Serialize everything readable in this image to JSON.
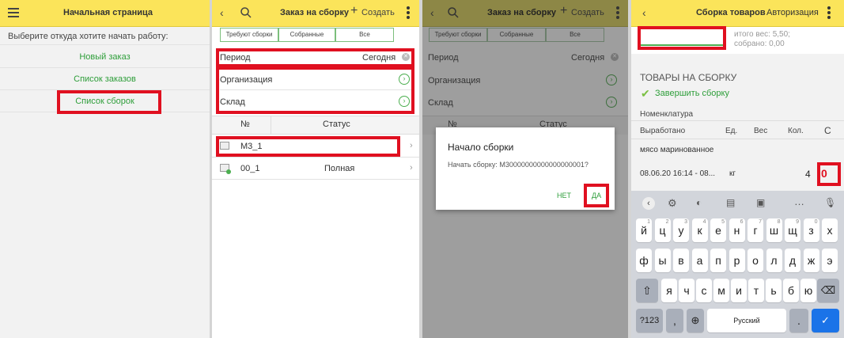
{
  "panel1": {
    "title": "Начальная страница",
    "prompt": "Выберите откуда хотите начать работу:",
    "items": [
      "Новый заказ",
      "Список заказов",
      "Список сборок"
    ]
  },
  "panel2": {
    "title": "Заказ на сборку",
    "create": "Создать",
    "tabs": [
      "Требуют сборки",
      "Собранные",
      "Все"
    ],
    "period_label": "Период",
    "period_value": "Сегодня",
    "org_label": "Организация",
    "warehouse_label": "Склад",
    "col_num": "№",
    "col_status": "Статус",
    "rows": [
      {
        "num": "М3_1",
        "status": ""
      },
      {
        "num": "00_1",
        "status": "Полная"
      }
    ]
  },
  "panel3": {
    "title": "Заказ на сборку",
    "create": "Создать",
    "tabs": [
      "Требуют сборки",
      "Собранные",
      "Все"
    ],
    "period_label": "Период",
    "period_value": "Сегодня",
    "org_label": "Организация",
    "warehouse_label": "Склад",
    "col_num": "№",
    "col_status": "Статус",
    "dialog": {
      "title": "Начало сборки",
      "message": "Начать сборку: М30000000000000000001?",
      "no": "НЕТ",
      "yes": "ДА"
    }
  },
  "panel4": {
    "title": "Сборка товаров",
    "auth": "Авторизация",
    "total_weight": "итого вес: 5,50;",
    "collected": "собрано: 0,00",
    "section": "ТОВАРЫ НА СБОРКУ",
    "finish": "Завершить сборку",
    "nomen": "Номенклатура",
    "col_produced": "Выработано",
    "col_unit": "Ед.",
    "col_weight": "Вес",
    "col_qty": "Кол.",
    "col_c": "С",
    "item_name": "мясо маринованное",
    "item_date": "08.06.20 16:14 - 08...",
    "item_unit": "кг",
    "item_qty": "4",
    "item_c": "0"
  },
  "keyboard": {
    "row1": [
      "й",
      "ц",
      "у",
      "к",
      "е",
      "н",
      "г",
      "ш",
      "щ",
      "з",
      "х"
    ],
    "row1_sup": [
      "1",
      "2",
      "3",
      "4",
      "5",
      "6",
      "7",
      "8",
      "9",
      "0",
      ""
    ],
    "row2": [
      "ф",
      "ы",
      "в",
      "а",
      "п",
      "р",
      "о",
      "л",
      "д",
      "ж",
      "э"
    ],
    "row3": [
      "я",
      "ч",
      "с",
      "м",
      "и",
      "т",
      "ь",
      "б",
      "ю"
    ],
    "num_key": "?123",
    "comma": ",",
    "space": "Русский",
    "period": "."
  }
}
